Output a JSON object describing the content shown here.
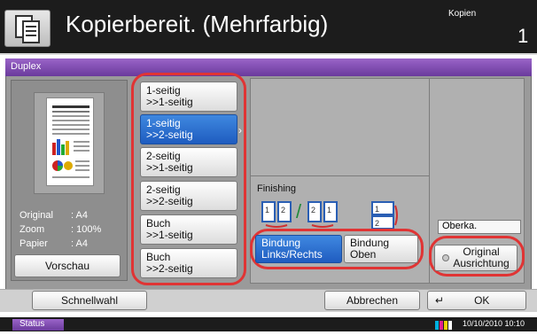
{
  "header": {
    "title": "Kopierbereit. (Mehrfarbig)",
    "job_label": "Kopien",
    "copy_count": "1"
  },
  "panel": {
    "title": "Duplex",
    "info": [
      {
        "label": "Original",
        "value": ": A4"
      },
      {
        "label": "Zoom",
        "value": ": 100%"
      },
      {
        "label": "Papier",
        "value": ": A4"
      }
    ],
    "preview_button": "Vorschau"
  },
  "duplex_options": [
    {
      "line1": "1-seitig",
      "line2": ">>1-seitig",
      "selected": false
    },
    {
      "line1": "1-seitig",
      "line2": ">>2-seitig",
      "selected": true
    },
    {
      "line1": "2-seitig",
      "line2": ">>1-seitig",
      "selected": false
    },
    {
      "line1": "2-seitig",
      "line2": ">>2-seitig",
      "selected": false
    },
    {
      "line1": "Buch",
      "line2": ">>1-seitig",
      "selected": false
    },
    {
      "line1": "Buch",
      "line2": ">>2-seitig",
      "selected": false
    }
  ],
  "finishing": {
    "label": "Finishing",
    "binding_left_right": {
      "line1": "Bindung",
      "line2": "Links/Rechts",
      "selected": true
    },
    "binding_top": {
      "line1": "Bindung",
      "line2": "Oben",
      "selected": false
    }
  },
  "orientation": {
    "label": "Oberka.",
    "button_line1": "Original",
    "button_line2": "Ausrichtung"
  },
  "bottom_bar": {
    "quick_setup": "Schnellwahl",
    "cancel": "Abbrechen",
    "ok": "OK"
  },
  "status_bar": {
    "status_label": "Status",
    "datetime": "10/10/2010  10:10"
  },
  "colors": {
    "accent_purple": "#7b4bb0",
    "selected_blue": "#2a6fd3",
    "highlight_red": "#e03434"
  }
}
